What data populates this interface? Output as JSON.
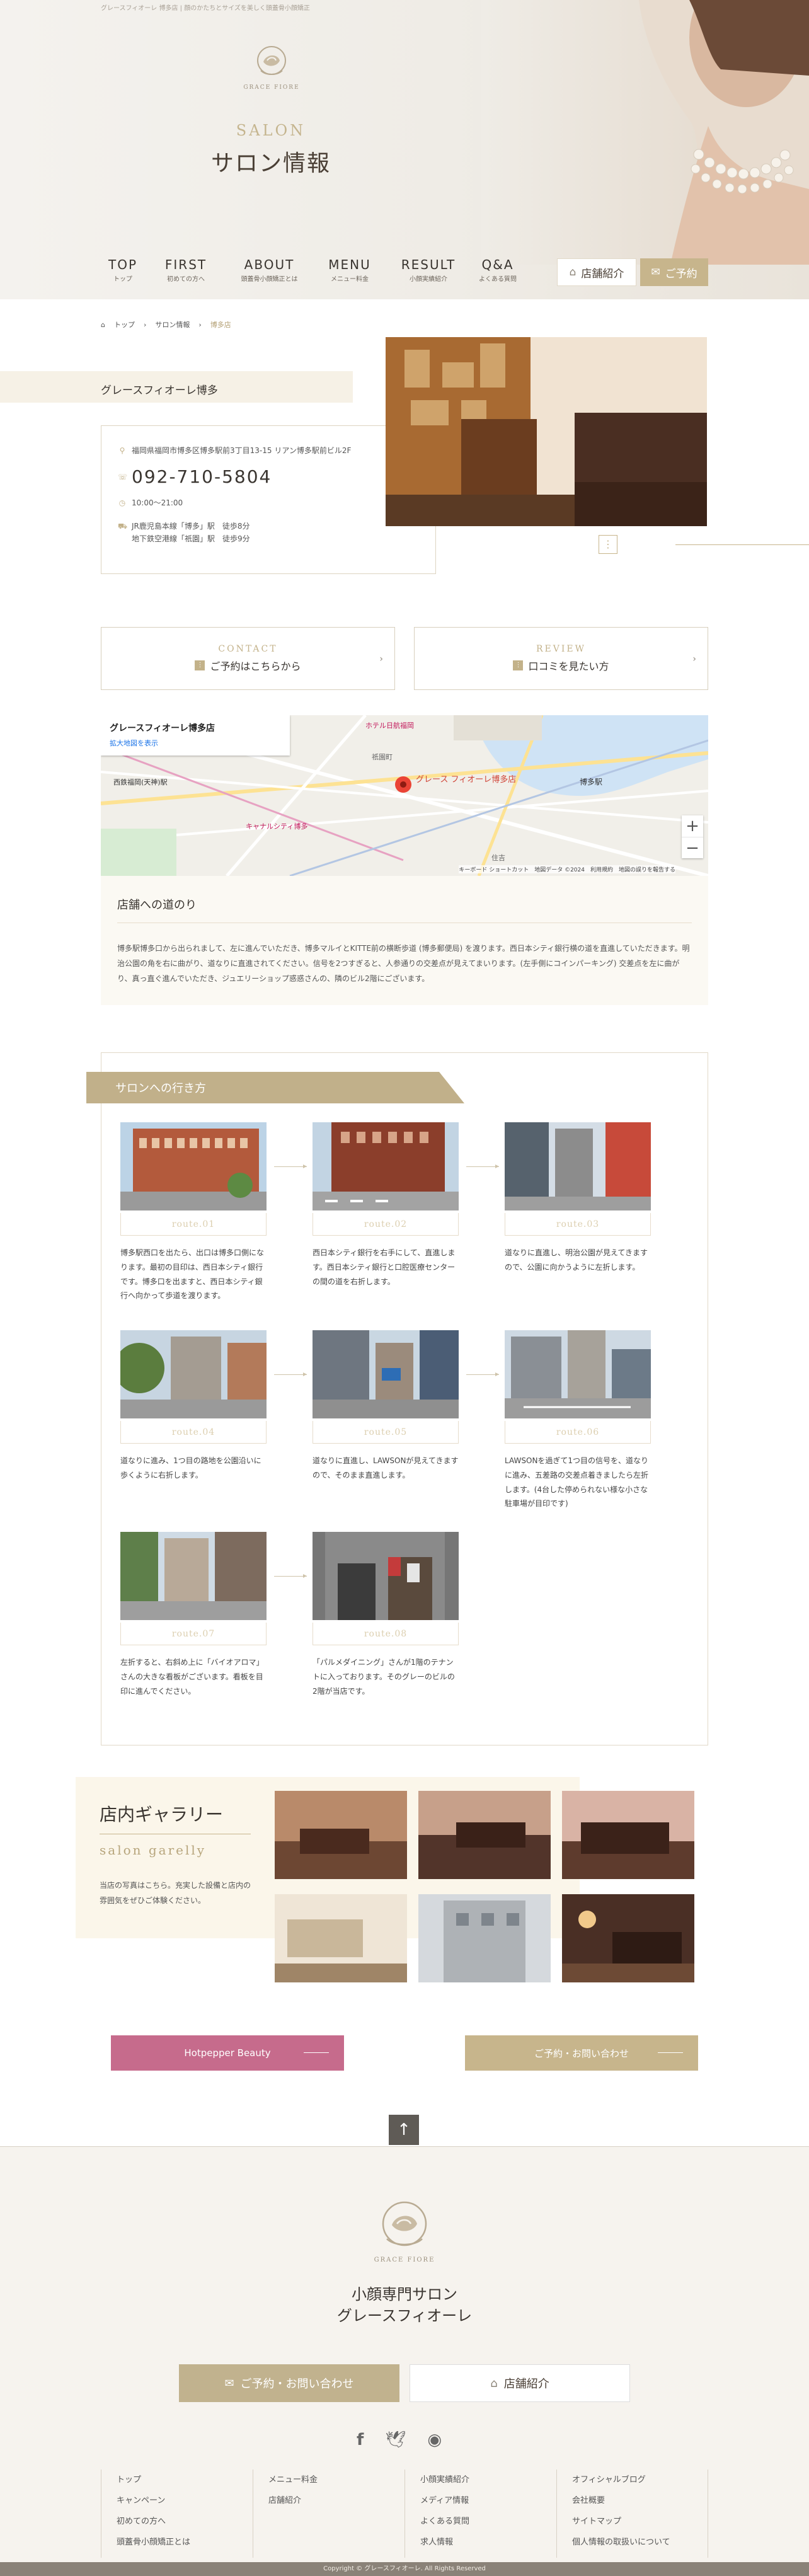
{
  "header": {
    "tagline": "グレースフィオーレ 博多店 | 顔のかたちとサイズを美しく頭蓋骨小顔矯正",
    "logo_text": "GRACE FIORE",
    "title_en": "SALON",
    "title_jp": "サロン情報"
  },
  "nav": [
    {
      "en": "TOP",
      "jp": "トップ"
    },
    {
      "en": "FIRST",
      "jp": "初めての方へ"
    },
    {
      "en": "ABOUT",
      "jp": "頭蓋骨小顔矯正とは"
    },
    {
      "en": "MENU",
      "jp": "メニュー料金"
    },
    {
      "en": "RESULT",
      "jp": "小顔実績紹介"
    },
    {
      "en": "Q&A",
      "jp": "よくある質問"
    }
  ],
  "header_buttons": {
    "shop": "店舗紹介",
    "reserve": "ご予約"
  },
  "breadcrumb": [
    "トップ",
    "サロン情報",
    "博多店"
  ],
  "shop": {
    "name": "グレースフィオーレ博多",
    "address": "福岡県福岡市博多区博多駅前3丁目13-15 リアン博多駅前ビル2F",
    "tel": "092-710-5804",
    "hours": "10:00〜21:00",
    "access_lines": [
      "JR鹿児島本線「博多」駅　徒歩8分",
      "地下鉄空港線「祇園」駅　徒歩9分"
    ]
  },
  "cta": [
    {
      "en": "CONTACT",
      "jp": "ご予約はこちらから"
    },
    {
      "en": "REVIEW",
      "jp": "口コミを見たい方"
    }
  ],
  "map": {
    "card_title": "グレースフィオーレ博多店",
    "card_link": "拡大地図を表示",
    "pin_label": "グレース フィオーレ博多店",
    "labels": [
      "ホテル日航福岡",
      "博多駅",
      "西鉄福岡(天神)駅",
      "キャナルシティ博多",
      "祇園町",
      "住吉"
    ],
    "footer": "キーボード ショートカット　地図データ ©2024　利用規約　地図の誤りを報告する",
    "zoom_in": "+",
    "zoom_out": "−"
  },
  "route_text": {
    "title": "店舗への道のり",
    "body": "博多駅博多口から出られまして、左に進んでいただき、博多マルイとKITTE前の横断歩道 (博多郵便局) を渡ります。西日本シティ銀行横の道を直進していただきます。明治公園の角を右に曲がり、道なりに直進されてください。信号を2つすぎると、人参通りの交差点が見えてまいります。(左手側にコインパーキング) 交差点を左に曲がり、真っ直ぐ進んでいただき、ジュエリーショップ惑惑さんの、隣のビル2階にございます。"
  },
  "access": {
    "title": "サロンへの行き方",
    "steps": [
      {
        "route": "route.01",
        "text": "博多駅西口を出たら、出口は博多口側になります。最初の目印は、西日本シティ銀行です。博多口を出ますと、西日本シティ銀行へ向かって歩道を渡ります。"
      },
      {
        "route": "route.02",
        "text": "西日本シティ銀行を右手にして、直進します。西日本シティ銀行と口腔医療センターの間の道を右折します。"
      },
      {
        "route": "route.03",
        "text": "道なりに直進し、明治公園が見えてきますので、公園に向かうように左折します。"
      },
      {
        "route": "route.04",
        "text": "道なりに進み、1つ目の路地を公園沿いに歩くように右折します。"
      },
      {
        "route": "route.05",
        "text": "道なりに直進し、LAWSONが見えてきますので、そのまま直進します。"
      },
      {
        "route": "route.06",
        "text": "LAWSONを過ぎて1つ目の信号を、道なりに進み、五差路の交差点着きましたら左折します。(4台した停められない様な小さな駐車場が目印です)"
      },
      {
        "route": "route.07",
        "text": "左折すると、右斜め上に「バイオアロマ」さんの大きな看板がございます。看板を目印に進んでください。"
      },
      {
        "route": "route.08",
        "text": "「パルメダイニング」さんが1階のテナントに入っております。そのグレーのビルの2階が当店です。"
      }
    ]
  },
  "gallery": {
    "title": "店内ギャラリー",
    "subtitle": "salon garelly",
    "desc": "当店の写真はこちら。充実した設備と店内の雰囲気をぜひご体験ください。"
  },
  "bottom_buttons": {
    "hotpepper": "Hotpepper Beauty",
    "contact": "ご予約・お問い合わせ"
  },
  "pagetop": "↑",
  "footer": {
    "logo_text": "GRACE FIORE",
    "title_line1": "小顔専門サロン",
    "title_line2": "グレースフィオーレ",
    "btn_contact": "ご予約・お問い合わせ",
    "btn_shop": "店舗紹介",
    "links": [
      [
        "トップ",
        "キャンペーン",
        "初めての方へ",
        "頭蓋骨小顔矯正とは"
      ],
      [
        "メニュー料金",
        "店舗紹介"
      ],
      [
        "小顔実績紹介",
        "メディア情報",
        "よくある質問",
        "求人情報"
      ],
      [
        "オフィシャルブログ",
        "会社概要",
        "サイトマップ",
        "個人情報の取扱いについて"
      ]
    ],
    "copyright": "Copyright © グレースフィオーレ. All Rights Reserved"
  }
}
